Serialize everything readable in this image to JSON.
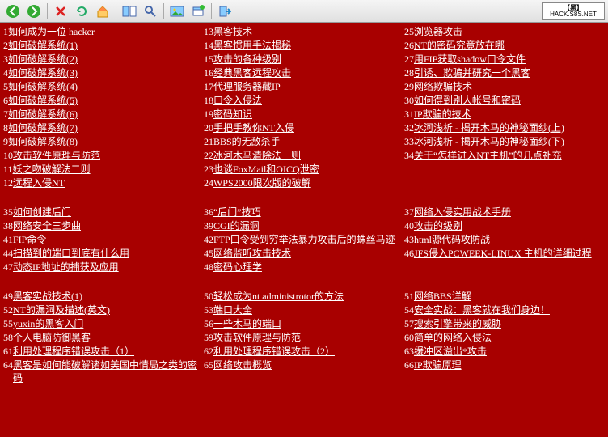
{
  "logo": {
    "top": "【黑】",
    "bottom": "HACK.S8S.NET"
  },
  "toolbar_icons": [
    "back-icon",
    "forward-icon",
    "stop-icon",
    "refresh-icon",
    "home-icon",
    "panes-icon",
    "search-icon",
    "pictures-icon",
    "new-window-icon",
    "exit-icon"
  ],
  "groups": [
    {
      "cols": [
        [
          {
            "n": "1",
            "t": "如何成为一位 hacker"
          },
          {
            "n": "2",
            "t": "如何破解系统(1)"
          },
          {
            "n": "3",
            "t": "如何破解系统(2)"
          },
          {
            "n": "4",
            "t": "如何破解系统(3)"
          },
          {
            "n": "5",
            "t": "如何破解系统(4)"
          },
          {
            "n": "6",
            "t": "如何破解系统(5)"
          },
          {
            "n": "7",
            "t": "如何破解系统(6)"
          },
          {
            "n": "8",
            "t": "如何破解系统(7)"
          },
          {
            "n": "9",
            "t": "如何破解系统(8)"
          },
          {
            "n": "10",
            "t": "攻击软件原理与防范"
          },
          {
            "n": "11",
            "t": "妖之吻破解法二则"
          },
          {
            "n": "12",
            "t": "远程入侵NT"
          }
        ],
        [
          {
            "n": "13",
            "t": "黑客技术"
          },
          {
            "n": "14",
            "t": "黑客惯用手法揭秘"
          },
          {
            "n": "15",
            "t": "攻击的各种级别"
          },
          {
            "n": "16",
            "t": "经典黑客远程攻击"
          },
          {
            "n": "17",
            "t": "代理服务器藏IP"
          },
          {
            "n": "18",
            "t": "口令入侵法"
          },
          {
            "n": "19",
            "t": "密码知识"
          },
          {
            "n": "20",
            "t": "手把手教你NT入侵"
          },
          {
            "n": "21",
            "t": "BBS的无敌杀手"
          },
          {
            "n": "22",
            "t": "冰河木马清除法一则"
          },
          {
            "n": "23",
            "t": "也谈FoxMail和OICQ泄密"
          },
          {
            "n": "24",
            "t": "WPS2000限次版的破解"
          }
        ],
        [
          {
            "n": "25",
            "t": "浏览器攻击"
          },
          {
            "n": "26",
            "t": "NT的密码究竟放在哪"
          },
          {
            "n": "27",
            "t": "用FIP获取shadow口令文件"
          },
          {
            "n": "28",
            "t": "引诱、欺骗并研究一个黑客"
          },
          {
            "n": "29",
            "t": "网络欺骗技术"
          },
          {
            "n": "30",
            "t": "如何得到别人帐号和密码"
          },
          {
            "n": "31",
            "t": "IP欺骗的技术"
          },
          {
            "n": "32",
            "t": "冰河浅析 - 揭开木马的神秘面纱(上)"
          },
          {
            "n": "33",
            "t": "冰河浅析 - 揭开木马的神秘面纱(下)"
          },
          {
            "n": "34",
            "t": "关于“怎样进入NT主机”的几点补充"
          }
        ]
      ]
    },
    {
      "cols": [
        [
          {
            "n": "35",
            "t": "如何创建后门"
          },
          {
            "n": "38",
            "t": "网络安全三步曲"
          },
          {
            "n": "41",
            "t": "FIP命令"
          },
          {
            "n": "44",
            "t": "扫描到的端口到底有什么用"
          },
          {
            "n": "47",
            "t": "动态IP地址的捕获及应用"
          }
        ],
        [
          {
            "n": "36",
            "t": "“后门”技巧"
          },
          {
            "n": "39",
            "t": "CGI的漏洞"
          },
          {
            "n": "42",
            "t": "FTP口令受到穷举法暴力攻击后的蛛丝马迹"
          },
          {
            "n": "45",
            "t": "网络监听攻击技术"
          },
          {
            "n": "48",
            "t": "密码心理学"
          }
        ],
        [
          {
            "n": "37",
            "t": "网络入侵实用战术手册"
          },
          {
            "n": "40",
            "t": "攻击的级别"
          },
          {
            "n": "43",
            "t": "html源代码攻防战"
          },
          {
            "n": "46",
            "t": "JFS侵入PCWEEK-LINUX 主机的详细过程"
          }
        ]
      ]
    },
    {
      "cols": [
        [
          {
            "n": "49",
            "t": "黑客实战技术(1)"
          },
          {
            "n": "52",
            "t": "NT的漏洞及描述(英文)"
          },
          {
            "n": "55",
            "t": "yuxin的黑客入门"
          },
          {
            "n": "58",
            "t": "个人电脑防御黑客"
          },
          {
            "n": "61",
            "t": "利用处理程序错误攻击（1）"
          },
          {
            "n": "64",
            "t": "黑客是如何能破解诸如美国中情局之类的密码"
          }
        ],
        [
          {
            "n": "50",
            "t": "轻松成为nt administrotor的方法"
          },
          {
            "n": "53",
            "t": "端口大全"
          },
          {
            "n": "56",
            "t": "一些木马的端口"
          },
          {
            "n": "59",
            "t": "攻击软件原理与防范"
          },
          {
            "n": "62",
            "t": "利用处理程序错误攻击（2）"
          },
          {
            "n": "65",
            "t": "网络攻击概览"
          }
        ],
        [
          {
            "n": "51",
            "t": "网络BBS详解"
          },
          {
            "n": "54",
            "t": "安全实战：黑客就在我们身边！"
          },
          {
            "n": "57",
            "t": "搜索引擎带来的威胁"
          },
          {
            "n": "60",
            "t": "简单的网络入侵法"
          },
          {
            "n": "63",
            "t": "缓冲区溢出*攻击"
          },
          {
            "n": "66",
            "t": "IP欺骗原理"
          }
        ]
      ]
    }
  ]
}
